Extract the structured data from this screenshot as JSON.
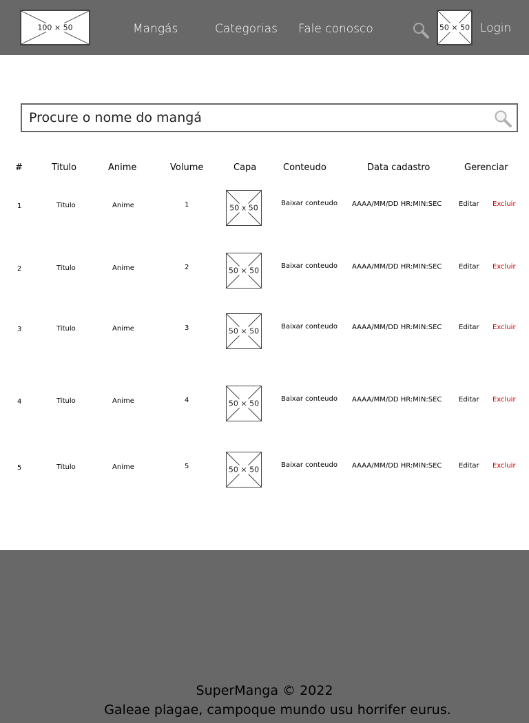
{
  "header": {
    "logo_label": "100 × 50",
    "nav": {
      "mangas": "Mangás",
      "categorias": "Categorias",
      "fale_conosco": "Fale conosco"
    },
    "avatar_label": "50 × 50",
    "login": "Login"
  },
  "search": {
    "placeholder": "Procure o nome do mangá"
  },
  "table": {
    "headers": {
      "num": "#",
      "titulo": "Titulo",
      "anime": "Anime",
      "volume": "Volume",
      "capa": "Capa",
      "conteudo": "Conteudo",
      "data": "Data cadastro",
      "gerenciar": "Gerenciar"
    },
    "rows": [
      {
        "num": "1",
        "titulo": "Titulo",
        "anime": "Anime",
        "volume": "1",
        "capa": "50 x 50",
        "conteudo": "Baixar conteudo",
        "data": "AAAA/MM/DD HR:MIN:SEC",
        "editar": "Editar",
        "excluir": "Excluir"
      },
      {
        "num": "2",
        "titulo": "Titulo",
        "anime": "Anime",
        "volume": "2",
        "capa": "50 × 50",
        "conteudo": "Baixar conteudo",
        "data": "AAAA/MM/DD HR:MIN:SEC",
        "editar": "Editar",
        "excluir": "Excluir"
      },
      {
        "num": "3",
        "titulo": "Titulo",
        "anime": "Anime",
        "volume": "3",
        "capa": "50 × 50",
        "conteudo": "Baixar conteudo",
        "data": "AAAA/MM/DD HR:MIN:SEC",
        "editar": "Editar",
        "excluir": "Excluir"
      },
      {
        "num": "4",
        "titulo": "Titulo",
        "anime": "Anime",
        "volume": "4",
        "capa": "50 × 50",
        "conteudo": "Baixar conteudo",
        "data": "AAAA/MM/DD HR:MIN:SEC",
        "editar": "Editar",
        "excluir": "Excluir"
      },
      {
        "num": "5",
        "titulo": "Titulo",
        "anime": "Anime",
        "volume": "5",
        "capa": "50 × 50",
        "conteudo": "Baixar conteudo",
        "data": "AAAA/MM/DD HR:MIN:SEC",
        "editar": "Editar",
        "excluir": "Excluir"
      }
    ]
  },
  "footer": {
    "title": "SuperManga © 2022",
    "text": "Galeae plagae, campoque mundo usu horrifer eurus."
  },
  "colors": {
    "header_bg": "#686868",
    "footer_bg": "#686868",
    "excluir": "#d00000"
  }
}
